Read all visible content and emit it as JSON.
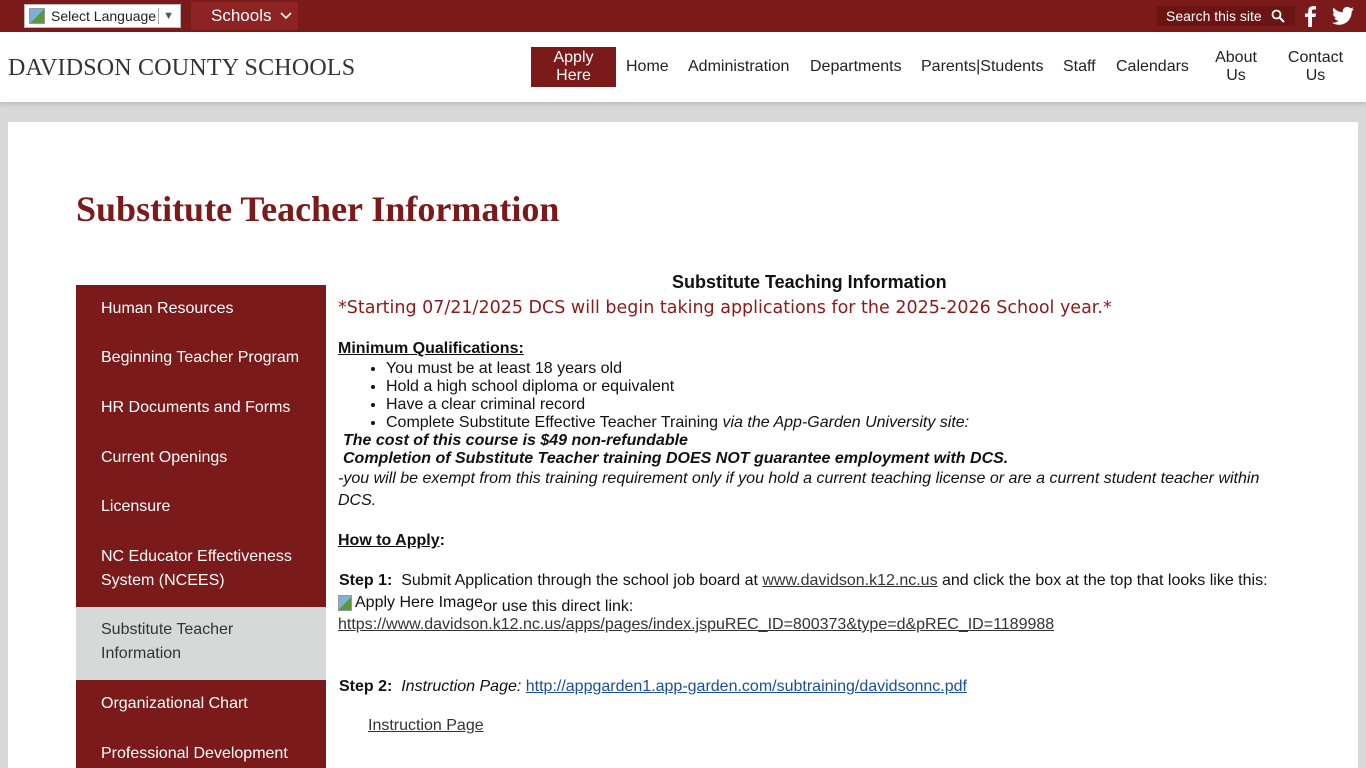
{
  "topbar": {
    "language_label": "Select Language",
    "language_arrow": "▼",
    "schools_label": "Schools",
    "search_placeholder": "Search this site"
  },
  "header": {
    "logo": "DAVIDSON COUNTY SCHOOLS",
    "apply_line1": "Apply",
    "apply_line2": "Here",
    "nav": {
      "home": "Home",
      "administration": "Administration",
      "departments": "Departments",
      "parents": "Parents|Students",
      "staff": "Staff",
      "calendars": "Calendars",
      "about_l1": "About",
      "about_l2": "Us",
      "contact_l1": "Contact",
      "contact_l2": "Us"
    }
  },
  "page_title": "Substitute Teacher Information",
  "sidebar": {
    "items": [
      {
        "label": "Human Resources"
      },
      {
        "label": "Beginning Teacher Program"
      },
      {
        "label": "HR Documents and Forms"
      },
      {
        "label": "Current Openings"
      },
      {
        "label": "Licensure"
      },
      {
        "label": "NC Educator Effectiveness System (NCEES)"
      },
      {
        "label": "Substitute Teacher Information",
        "active": true
      },
      {
        "label": "Organizational Chart"
      },
      {
        "label": "Professional Development"
      }
    ]
  },
  "content": {
    "heading": "Substitute Teaching Information",
    "notice": "*Starting 07/21/2025 DCS will begin taking applications for the 2025-2026 School year.*",
    "min_qual_heading": "Minimum Qualifications:",
    "qualifications": [
      "You must be at least 18 years old",
      "Hold a high school diploma or equivalent",
      "Have a clear criminal record",
      "Complete Substitute Effective Teacher Training"
    ],
    "training_via": " via the App-Garden University site:",
    "cost_note": "The cost of this course is $49 non-refundable",
    "guarantee_note": "Completion of Substitute Teacher training DOES NOT guarantee employment with DCS.",
    "exempt_line1": "-you will be exempt from this training requirement only if you hold a current teaching license or are a current student teacher within",
    "exempt_line2": "DCS.",
    "how_to_apply": "How to Apply",
    "how_colon": ":",
    "step1_label": "Step 1:",
    "step1_text": "Submit Application through the school job board at ",
    "step1_link": "www.davidson.k12.nc.us",
    "step1_after": " and click the box at the top that looks like this:",
    "apply_img_alt": "Apply Here Image",
    "direct_link_text": "or use this direct link:",
    "direct_link": "https://www.davidson.k12.nc.us/apps/pages/index.jspuREC_ID=800373&type=d&pREC_ID=1189988",
    "step2_label": "Step 2:",
    "step2_text": "Instruction Page: ",
    "step2_link": "http://appgarden1.app-garden.com/subtraining/davidsonnc.pdf",
    "instruction_page_link": "Instruction Page"
  }
}
